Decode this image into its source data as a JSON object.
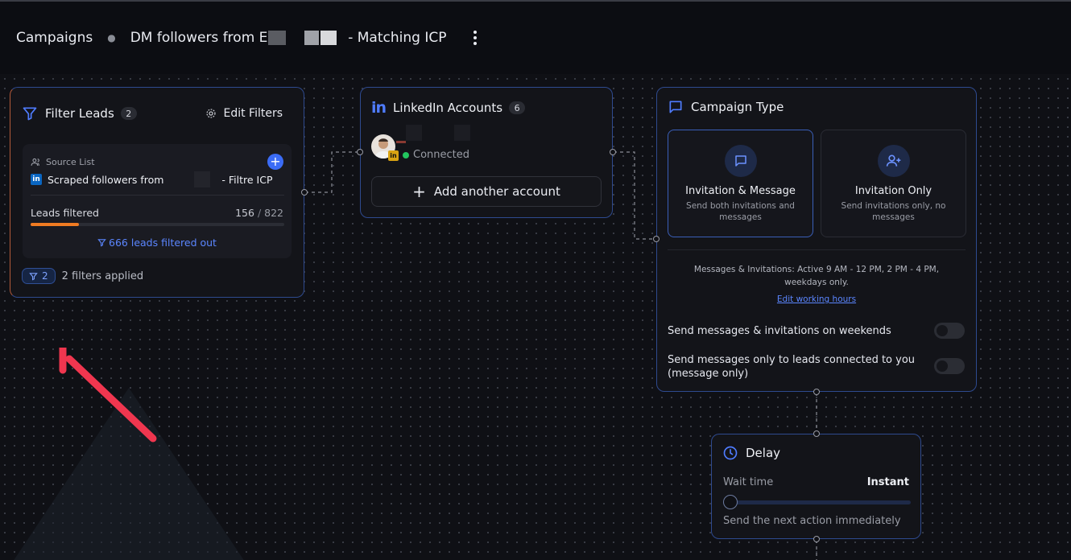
{
  "header": {
    "breadcrumb_root": "Campaigns",
    "campaign_name_prefix": "DM followers from E",
    "campaign_name_suffix": "- Matching ICP"
  },
  "filter_node": {
    "title": "Filter Leads",
    "count": "2",
    "edit_label": "Edit Filters",
    "source_label": "Source List",
    "source_name_prefix": "Scraped followers from",
    "source_name_suffix": "- Filtre ICP",
    "leads_label": "Leads filtered",
    "leads_count": "156",
    "leads_total": "822",
    "progress_fraction": 0.19,
    "filtered_out": "666 leads filtered out",
    "chip_count": "2",
    "filters_applied": "2 filters applied"
  },
  "linkedin_node": {
    "title": "LinkedIn Accounts",
    "count": "6",
    "status": "Connected",
    "add_label": "Add another account"
  },
  "campaign_type_node": {
    "title": "Campaign Type",
    "options": [
      {
        "title": "Invitation & Message",
        "desc": "Send both invitations and messages"
      },
      {
        "title": "Invitation Only",
        "desc": "Send invitations only, no messages"
      }
    ],
    "schedule": "Messages & Invitations: Active 9 AM - 12 PM, 2 PM - 4 PM, weekdays only.",
    "edit_hours": "Edit working hours",
    "weekend_label": "Send messages & invitations on weekends",
    "connected_only_label": "Send messages only to leads connected to you (message only)"
  },
  "delay_node": {
    "title": "Delay",
    "wait_label": "Wait time",
    "wait_value": "Instant",
    "description": "Send the next action immediately"
  },
  "colors": {
    "accent": "#3b6cf6",
    "node_border": "#2e4a8f",
    "progress": "#f07b22",
    "annotation_arrow": "#f0364f",
    "connected": "#22c55e"
  }
}
